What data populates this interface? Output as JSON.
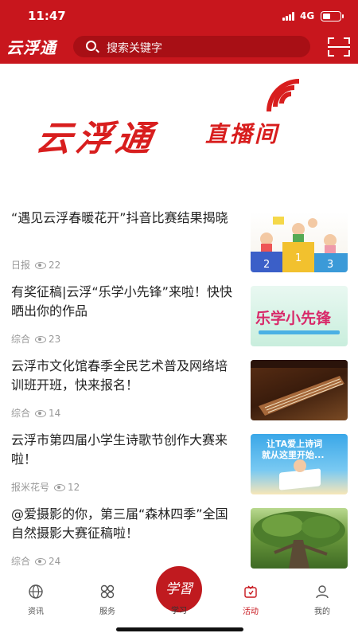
{
  "status_bar": {
    "time": "11:47",
    "network": "4G"
  },
  "header": {
    "logo": "云浮通",
    "search_placeholder": "搜索关键字"
  },
  "banner": {
    "brand": "云浮通",
    "brand_suffix": "直播间"
  },
  "news": [
    {
      "title": "“遇见云浮春暖花开”抖音比赛结果揭晓",
      "source": "日报",
      "views": "22",
      "thumb": "children-podium"
    },
    {
      "title": "有奖征稿|云浮“乐学小先锋”来啦！快快晒出你的作品",
      "source": "综合",
      "views": "23",
      "thumb": "乐学小先锋"
    },
    {
      "title": "云浮市文化馆春季全民艺术普及网络培训班开班，快来报名！",
      "source": "综合",
      "views": "14",
      "thumb": "guzheng"
    },
    {
      "title": "云浮市第四届小学生诗歌节创作大赛来啦！",
      "source": "报米花号",
      "views": "12",
      "thumb": "让TA爱上诗词 就从这里开始..."
    },
    {
      "title": "@爱摄影的你，第三届“森林四季”全国自然摄影大赛征稿啦！",
      "source": "综合",
      "views": "24",
      "thumb": "forest-tree"
    }
  ],
  "thumb_text": {
    "t2": "乐学小先锋",
    "t4_line1": "让TA爱上诗词",
    "t4_line2": "就从这里开始..."
  },
  "tabbar": {
    "tabs": [
      {
        "label": "资讯",
        "icon": "globe-icon"
      },
      {
        "label": "服务",
        "icon": "grid-icon"
      },
      {
        "label": "学习",
        "icon": "study-logo"
      },
      {
        "label": "活动",
        "icon": "activity-icon"
      },
      {
        "label": "我的",
        "icon": "user-icon"
      }
    ],
    "center_logo": "学習"
  },
  "colors": {
    "brand_red": "#c8161d",
    "text": "#222222",
    "meta": "#999999"
  }
}
